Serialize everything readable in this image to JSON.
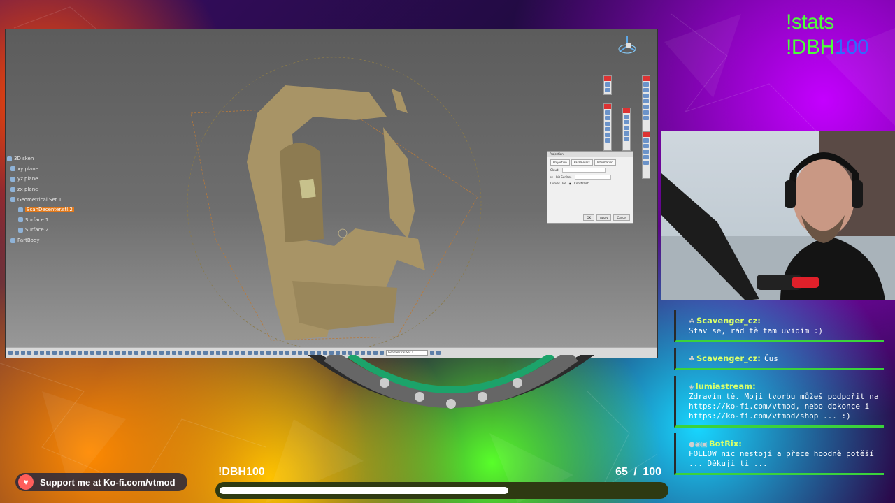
{
  "overlay": {
    "commands": [
      "!stats",
      "!DBH100"
    ],
    "kofi_text": "Support me at Ko-fi.com/vtmod",
    "goal_label": "!DBH100",
    "goal_current": "65",
    "goal_separator": "/",
    "goal_total": "100",
    "goal_fraction": 0.65
  },
  "catia": {
    "tree": [
      {
        "label": "3D sken",
        "selected": false
      },
      {
        "label": "xy plane",
        "selected": false
      },
      {
        "label": "yz plane",
        "selected": false
      },
      {
        "label": "zx plane",
        "selected": false
      },
      {
        "label": "Geometrical Set.1",
        "selected": false
      },
      {
        "label": "ScanDecenter.stl.2",
        "selected": true
      },
      {
        "label": "Surface.1",
        "selected": false
      },
      {
        "label": "Surface.2",
        "selected": false
      },
      {
        "label": "PartBody",
        "selected": false
      }
    ],
    "dialog": {
      "title": "Projection",
      "tabs": [
        "Projection",
        "Parameters",
        "Information"
      ],
      "field_label": "Cloud:",
      "option_label": "Init Surface",
      "curves_label": "Curves Use",
      "radio_label": "Constraint",
      "ok": "OK",
      "apply": "Apply",
      "cancel": "Cancel"
    },
    "status_combo": "Geometrical Set.1"
  },
  "chat": [
    {
      "user": "Scavenger_cz:",
      "text": "Stav se, rád tě tam uvidím :)"
    },
    {
      "user": "Scavenger_cz:",
      "text": "Čus"
    },
    {
      "user": "lumiastream:",
      "text": "Zdravím tě. Moji tvorbu můžeš podpořit na https://ko-fi.com/vtmod, nebo dokonce i https://ko-fi.com/vtmod/shop ... :)"
    },
    {
      "user": "BotRix:",
      "text": "FOLLOW nic nestojí a přece hoodně potěší ... Děkuji ti ..."
    }
  ],
  "colors": {
    "command_green": "#4dff39",
    "command_blue": "#2f6aff",
    "chat_user": "#d9ff6a",
    "selected_tree": "#e0781a"
  }
}
